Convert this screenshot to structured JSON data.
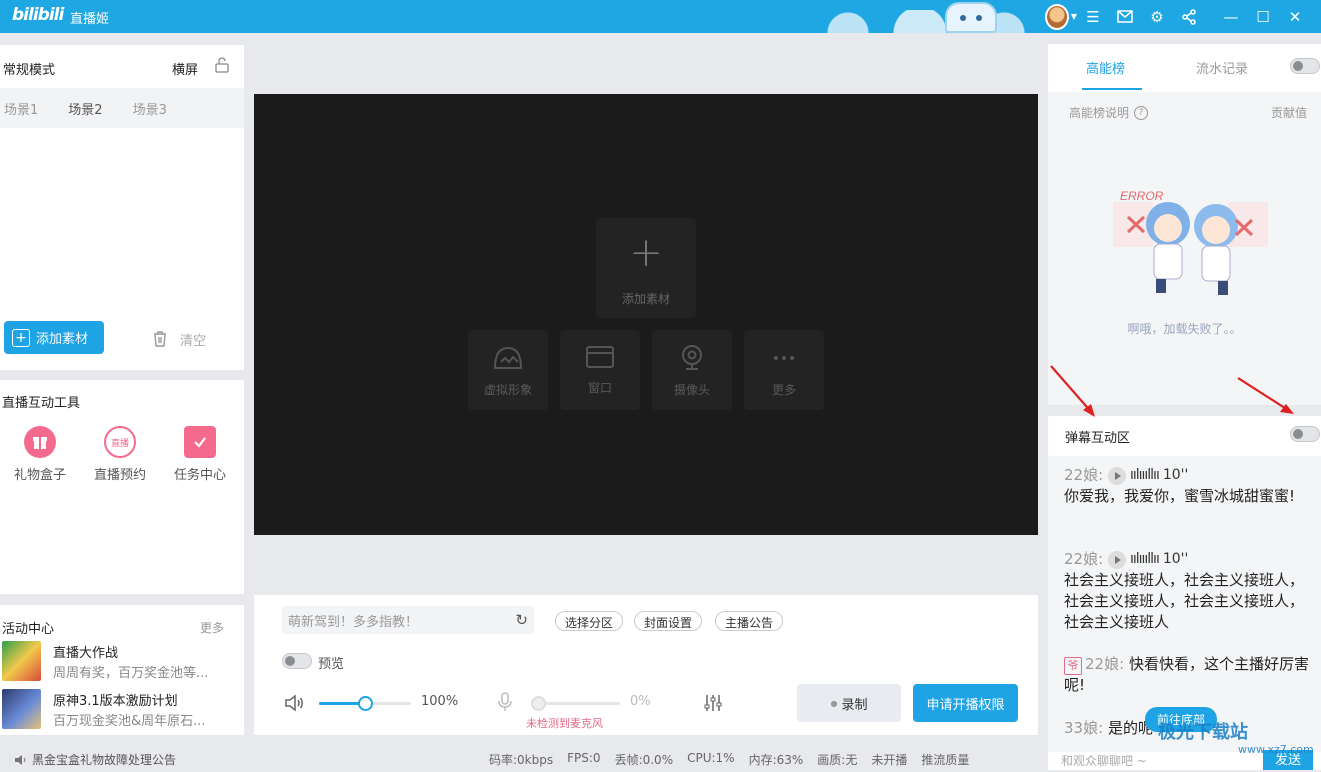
{
  "titlebar": {
    "logo": "bilibili",
    "title": "直播姬"
  },
  "scene_panel": {
    "mode": "常规模式",
    "orientation": "横屏",
    "tabs": [
      "场景1",
      "场景2",
      "场景3"
    ],
    "active_tab": "场景2",
    "add_label": "添加素材",
    "clear_label": "清空"
  },
  "tools": {
    "title": "直播互动工具",
    "items": [
      {
        "label": "礼物盒子",
        "icon": "gift-box-icon",
        "color": "#f46a8c"
      },
      {
        "label": "直播预约",
        "icon": "live-reserve-icon",
        "color": "#f46a8c",
        "badge": "直播"
      },
      {
        "label": "任务中心",
        "icon": "task-check-icon",
        "color": "#f46a8c"
      }
    ]
  },
  "activity": {
    "title": "活动中心",
    "more": "更多",
    "items": [
      {
        "name": "直播大作战",
        "desc": "周周有奖，百万奖金池等..."
      },
      {
        "name": "原神3.1版本激励计划",
        "desc": "百万现金奖池&周年原石..."
      }
    ]
  },
  "canvas": {
    "add_label": "添加素材",
    "sources": [
      {
        "label": "虚拟形象",
        "icon": "virtual-avatar-icon"
      },
      {
        "label": "窗口",
        "icon": "window-icon"
      },
      {
        "label": "摄像头",
        "icon": "camera-icon"
      },
      {
        "label": "更多",
        "icon": "more-icon"
      }
    ]
  },
  "controls": {
    "title_placeholder": "萌新驾到！多多指教！",
    "pills": [
      "选择分区",
      "封面设置",
      "主播公告"
    ],
    "preview_label": "预览",
    "volume": 0.5,
    "volume_pct": "100%",
    "mic_pct": "0%",
    "mic_warning": "未检测到麦克风",
    "record_label": "录制",
    "apply_label": "申请开播权限"
  },
  "statusbar": {
    "notice": "黑金宝盒礼物故障处理公告",
    "stats": [
      "码率:0kbps",
      "FPS:0",
      "丢帧:0.0%",
      "CPU:1%",
      "内存:63%",
      "画质:无",
      "未开播",
      "推流质量"
    ]
  },
  "rank": {
    "tabs": [
      "高能榜",
      "流水记录"
    ],
    "active_tab": "高能榜",
    "info_label": "高能榜说明",
    "contrib_label": "贡献值",
    "error_text": "啊哦，加载失败了。。",
    "error_art_label": "ERROR"
  },
  "danmu": {
    "title": "弹幕互动区",
    "messages": [
      {
        "user": "22娘:",
        "voice": "10''",
        "text": "你爱我，我爱你，蜜雪冰城甜蜜蜜!"
      },
      {
        "user": "22娘:",
        "voice": "10''",
        "text": "社会主义接班人，社会主义接班人，社会主义接班人，社会主义接班人，社会主义接班人"
      },
      {
        "user": "22娘:",
        "badge": "爷",
        "text": "快看快看，这个主播好厉害呢!"
      },
      {
        "user": "33娘:",
        "text": "是的呢"
      }
    ],
    "goto_bottom": "前往底部",
    "input_placeholder": "和观众聊聊吧 ~",
    "send_label": "发送"
  },
  "watermark": {
    "text": "极光下载站",
    "sub": "www.xz7.com"
  }
}
